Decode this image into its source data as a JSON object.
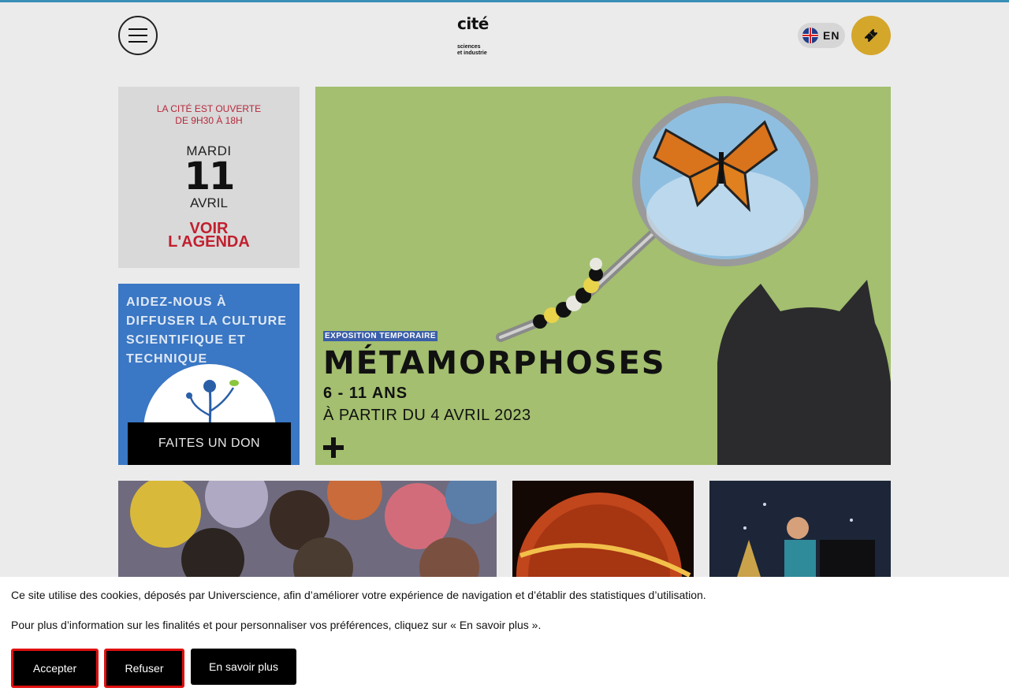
{
  "header": {
    "logo_line1": "cité",
    "logo_line2": "sciences",
    "logo_line3": "et industrie",
    "lang_label": "EN"
  },
  "agenda": {
    "open_line1": "LA CITÉ EST OUVERTE",
    "open_line2": "DE 9H30 À 18H",
    "day": "MARDI",
    "date_num": "11",
    "month": "AVRIL",
    "link_line1": "VOIR",
    "link_line2": "L'AGENDA"
  },
  "donation": {
    "text": "AIDEZ-NOUS À DIFFUSER LA CULTURE SCIENTIFIQUE ET TECHNIQUE",
    "button_label": "FAITES UN DON"
  },
  "hero": {
    "tag": "EXPOSITION TEMPORAIRE",
    "title": "MÉTAMORPHOSES",
    "age": "6 - 11 ANS",
    "date": "À PARTIR DU 4 AVRIL 2023"
  },
  "cookie": {
    "line1": "Ce site utilise des cookies, déposés par Universcience, afin d’améliorer votre expérience de navigation et d’établir des statistiques d’utilisation.",
    "line2": "Pour plus d’information sur les finalités et pour personnaliser vos préférences, cliquez sur « En savoir plus ».",
    "accept_label": "Accepter",
    "refuse_label": "Refuser",
    "more_label": "En savoir plus"
  },
  "colors": {
    "accent_gold": "#d4a62a",
    "agenda_red": "#c11f2e",
    "donation_blue": "#3a77c4",
    "hero_green": "#a3bf6f",
    "cookie_border_red": "#e01010"
  },
  "icons": [
    "menu-icon",
    "uk-flag-icon",
    "ticket-icon",
    "plus-icon"
  ]
}
